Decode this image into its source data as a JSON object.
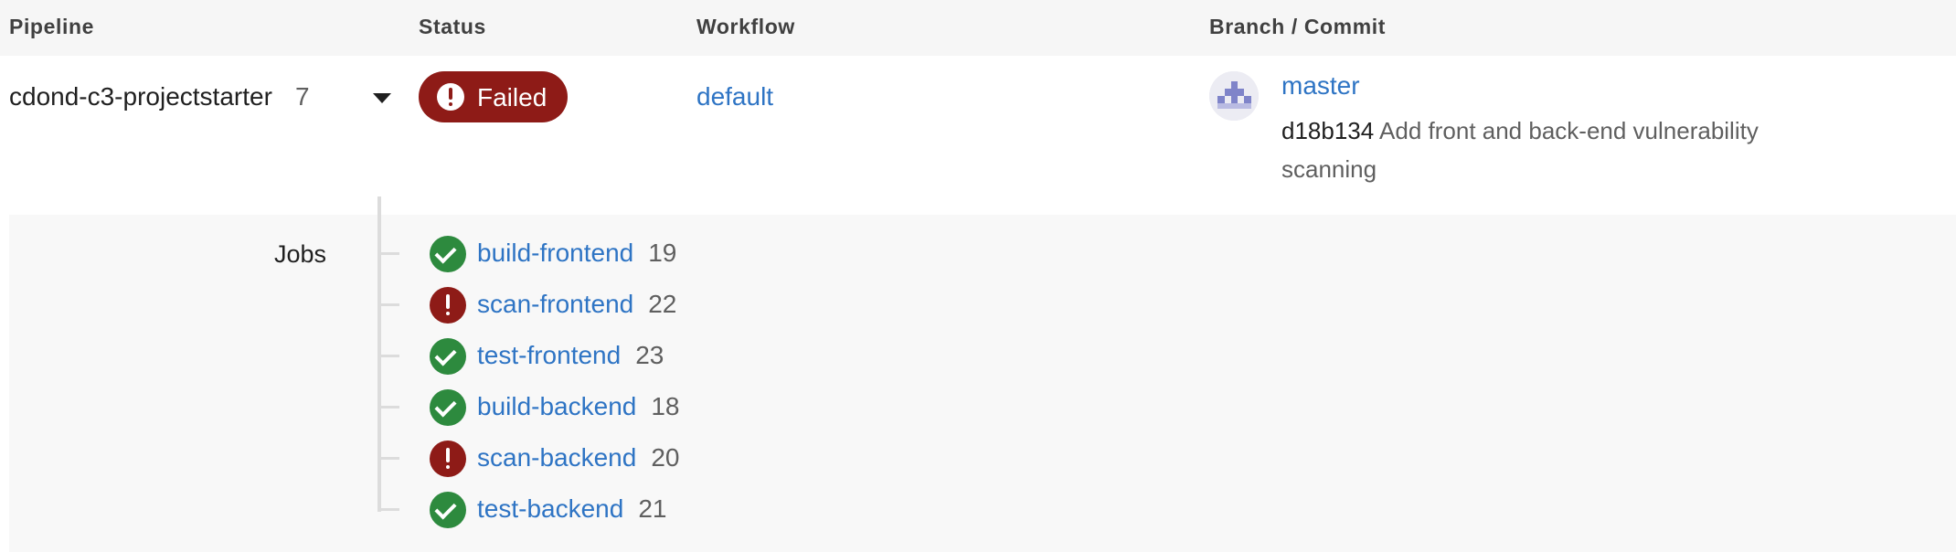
{
  "table": {
    "headers": {
      "pipeline": "Pipeline",
      "status": "Status",
      "workflow": "Workflow",
      "branch_commit": "Branch / Commit"
    }
  },
  "pipeline": {
    "name": "cdond-c3-projectstarter",
    "number": "7",
    "status": "Failed",
    "status_color": "#8e1b17",
    "workflow": "default",
    "branch": "master",
    "commit_sha": "d18b134",
    "commit_message": "Add front and back-end vulnerability scanning",
    "avatar_icon": "identicon-avatar"
  },
  "jobs": {
    "label": "Jobs",
    "items": [
      {
        "name": "build-frontend",
        "id": "19",
        "status": "success"
      },
      {
        "name": "scan-frontend",
        "id": "22",
        "status": "failed"
      },
      {
        "name": "test-frontend",
        "id": "23",
        "status": "success"
      },
      {
        "name": "build-backend",
        "id": "18",
        "status": "success"
      },
      {
        "name": "scan-backend",
        "id": "20",
        "status": "failed"
      },
      {
        "name": "test-backend",
        "id": "21",
        "status": "success"
      }
    ]
  },
  "colors": {
    "link": "#2e74c4",
    "success": "#2d8a3e",
    "failed": "#8e1b17"
  }
}
